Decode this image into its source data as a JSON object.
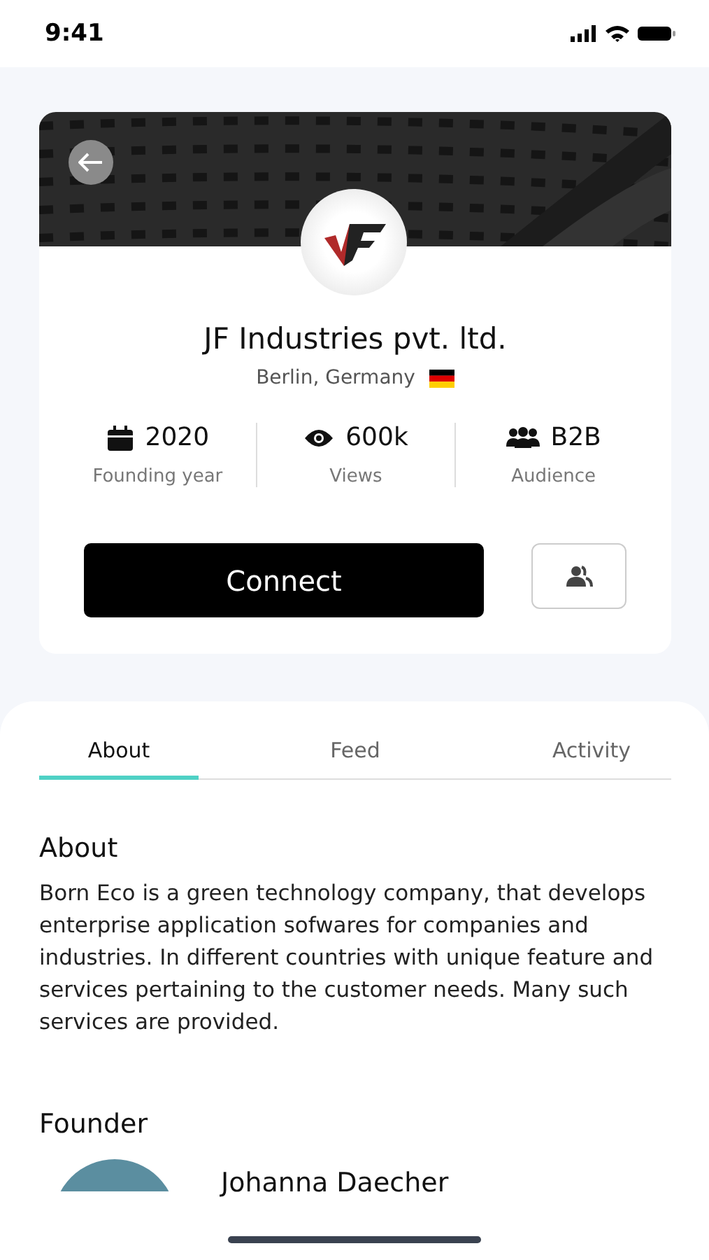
{
  "status_bar": {
    "time": "9:41"
  },
  "profile": {
    "name": "JF Industries pvt. ltd.",
    "location": "Berlin, Germany"
  },
  "stats": [
    {
      "kind": "calendar",
      "value": "2020",
      "label": "Founding year"
    },
    {
      "kind": "eye",
      "value": "600k",
      "label": "Views"
    },
    {
      "kind": "group",
      "value": "B2B",
      "label": "Audience"
    }
  ],
  "buttons": {
    "connect": "Connect"
  },
  "tabs": [
    {
      "label": "About",
      "selected": true
    },
    {
      "label": "Feed",
      "selected": false
    },
    {
      "label": "Activity",
      "selected": false
    }
  ],
  "about": {
    "heading": "About",
    "text": "Born Eco is a green technology company, that develops enterprise application sofwares for companies and industries. In different countries with unique feature and services pertaining to the customer needs. Many such services are provided."
  },
  "founder": {
    "heading": "Founder",
    "name": "Johanna Daecher"
  }
}
